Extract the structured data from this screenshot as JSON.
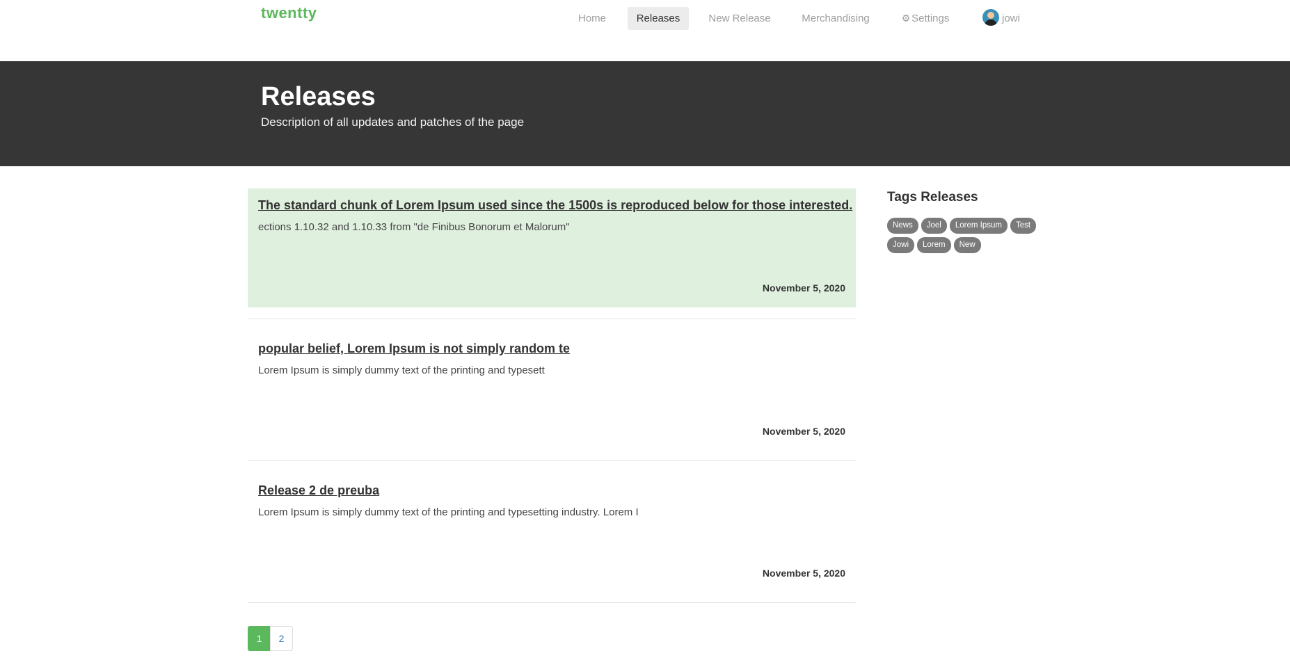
{
  "brand": "twentty",
  "nav": {
    "home": "Home",
    "releases": "Releases",
    "new_release": "New Release",
    "merchandising": "Merchandising",
    "settings": "Settings",
    "user": "jowi"
  },
  "hero": {
    "title": "Releases",
    "subtitle": "Description of all updates and patches of the page"
  },
  "posts": [
    {
      "title": "The standard chunk of Lorem Ipsum used since the 1500s is reproduced below for those interested.",
      "excerpt": "ections 1.10.32 and 1.10.33 from \"de Finibus Bonorum et Malorum\"",
      "date": "November 5, 2020"
    },
    {
      "title": "popular belief, Lorem Ipsum is not simply random te",
      "excerpt": "Lorem Ipsum is simply dummy text of the printing and typesett",
      "date": "November 5, 2020"
    },
    {
      "title": "Release 2 de preuba",
      "excerpt": "Lorem Ipsum is simply dummy text of the printing and typesetting industry. Lorem I",
      "date": "November 5, 2020"
    }
  ],
  "pagination": [
    "1",
    "2"
  ],
  "sidebar": {
    "title": "Tags Releases",
    "tags": [
      "News",
      "Joel",
      "Lorem Ipsum",
      "Test",
      "Jowi",
      "Lorem",
      "New"
    ]
  },
  "colors": {
    "accent": "#5cb85c",
    "hero_bg": "#363636",
    "highlight_bg": "#e0f0df",
    "tag_bg": "#7a7a7a"
  },
  "icons": {
    "settings": "gear-icon",
    "user": "avatar"
  }
}
